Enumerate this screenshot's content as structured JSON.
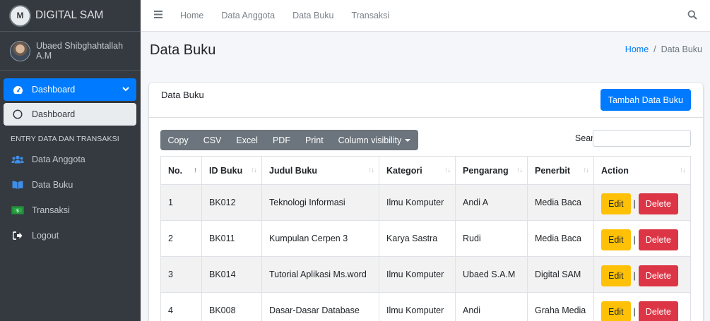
{
  "brand": {
    "name": "DIGITAL SAM",
    "logo_letter": "M"
  },
  "user": {
    "name": "Ubaed Shibghahtallah A.M"
  },
  "sidebar": {
    "dashboard_label": "Dashboard",
    "dashboard_sub_label": "Dashboard",
    "section_header": "ENTRY DATA DAN TRANSAKSI",
    "items": [
      {
        "label": "Data Anggota",
        "icon": "users-icon"
      },
      {
        "label": "Data Buku",
        "icon": "book-icon"
      },
      {
        "label": "Transaksi",
        "icon": "money-icon"
      },
      {
        "label": "Logout",
        "icon": "sign-out-icon"
      }
    ]
  },
  "navbar": {
    "links": [
      "Home",
      "Data Anggota",
      "Data Buku",
      "Transaksi"
    ]
  },
  "page": {
    "title": "Data Buku",
    "breadcrumb": {
      "home": "Home",
      "separator": "/",
      "current": "Data Buku"
    }
  },
  "card": {
    "title": "Data Buku",
    "add_button": "Tambah Data Buku"
  },
  "datatable": {
    "buttons": [
      "Copy",
      "CSV",
      "Excel",
      "PDF",
      "Print",
      "Column visibility"
    ],
    "search_label": "Search:",
    "search_value": "",
    "columns": [
      "No.",
      "ID Buku",
      "Judul Buku",
      "Kategori",
      "Pengarang",
      "Penerbit",
      "Action"
    ],
    "rows": [
      {
        "no": "1",
        "id": "BK012",
        "judul": "Teknologi Informasi",
        "kategori": "Ilmu Komputer",
        "pengarang": "Andi A",
        "penerbit": "Media Baca"
      },
      {
        "no": "2",
        "id": "BK011",
        "judul": "Kumpulan Cerpen 3",
        "kategori": "Karya Sastra",
        "pengarang": "Rudi",
        "penerbit": "Media Baca"
      },
      {
        "no": "3",
        "id": "BK014",
        "judul": "Tutorial Aplikasi Ms.word",
        "kategori": "Ilmu Komputer",
        "pengarang": "Ubaed S.A.M",
        "penerbit": "Digital SAM"
      },
      {
        "no": "4",
        "id": "BK008",
        "judul": "Dasar-Dasar Database",
        "kategori": "Ilmu Komputer",
        "pengarang": "Andi",
        "penerbit": "Graha Media"
      }
    ],
    "edit_label": "Edit",
    "delete_label": "Delete",
    "action_separator": "|"
  },
  "colors": {
    "sidebar_bg": "#343a40",
    "primary": "#007bff",
    "warning": "#ffc107",
    "danger": "#dc3545",
    "secondary": "#6c757d"
  }
}
